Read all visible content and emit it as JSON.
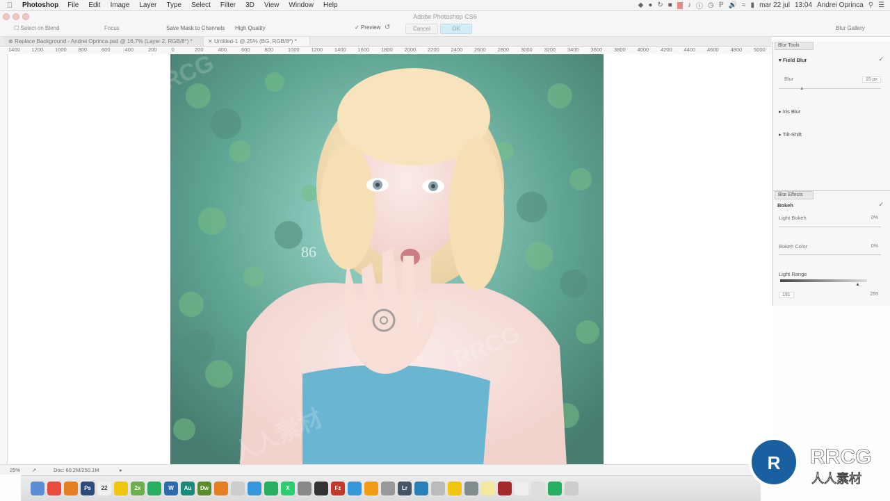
{
  "menubar": {
    "app": "Photoshop",
    "menus": [
      "File",
      "Edit",
      "Image",
      "Layer",
      "Type",
      "Select",
      "Filter",
      "3D",
      "View",
      "Window",
      "Help"
    ],
    "date": "mar 22 jul",
    "time": "13:04",
    "user": "Andrei Oprinca"
  },
  "window": {
    "title": "Adobe Photoshop CS6"
  },
  "options": {
    "select_on_blend": "Select on Blend",
    "focus": "Focus",
    "save_mask": "Save Mask to Channels",
    "high_quality": "High Quality",
    "preview": "Preview",
    "cancel": "Cancel",
    "ok": "OK",
    "blur_gallery": "Blur Gallery"
  },
  "tabs": [
    {
      "label": "Replace Background - Andrei Oprinca.psd @ 16.7% (Layer 2, RGB/8*) *"
    },
    {
      "label": "Untitled-1 @ 25% (BG, RGB/8*) *"
    }
  ],
  "ruler": {
    "ticks": [
      "1400",
      "1200",
      "1000",
      "800",
      "600",
      "400",
      "200",
      "0",
      "200",
      "400",
      "600",
      "800",
      "1000",
      "1200",
      "1400",
      "1600",
      "1800",
      "2000",
      "2200",
      "2400",
      "2600",
      "2800",
      "3000",
      "3200",
      "3400",
      "3600",
      "3800",
      "4000",
      "4200",
      "4400",
      "4600",
      "4800",
      "5000"
    ]
  },
  "status": {
    "zoom": "25%",
    "doc": "Doc: 60.2M/250.1M"
  },
  "blur_tools": {
    "tab": "Blur Tools",
    "field_blur": "Field Blur",
    "blur_label": "Blur",
    "blur_value": "15 px",
    "blur_level": 0.23,
    "iris_blur": "Iris Blur",
    "tilt_shift": "Tilt-Shift"
  },
  "blur_effects": {
    "tab": "Blur Effects",
    "bokeh": "Bokeh",
    "light_bokeh": "Light Bokeh",
    "light_bokeh_value": "0%",
    "bokeh_color": "Bokeh Color",
    "bokeh_color_value": "0%",
    "light_range": "Light Range",
    "light_range_min": "191",
    "light_range_max": "255"
  },
  "dock": {
    "items": [
      {
        "label": "",
        "color": "#5a8fd8",
        "name": "finder-icon"
      },
      {
        "label": "",
        "color": "#e74c3c",
        "name": "chrome-icon"
      },
      {
        "label": "",
        "color": "#e67e22",
        "name": "firefox-icon"
      },
      {
        "label": "Ps",
        "color": "#2c4a7a",
        "name": "photoshop-icon"
      },
      {
        "label": "22",
        "color": "#f0f0f0",
        "name": "calendar-icon"
      },
      {
        "label": "",
        "color": "#f1c40f",
        "name": "notes-icon"
      },
      {
        "label": "2x",
        "color": "#6ab04c",
        "name": "app-icon"
      },
      {
        "label": "",
        "color": "#27ae60",
        "name": "spotify-icon"
      },
      {
        "label": "W",
        "color": "#2b6cb0",
        "name": "word-icon"
      },
      {
        "label": "Au",
        "color": "#1a8a7a",
        "name": "audition-icon"
      },
      {
        "label": "Dw",
        "color": "#5b8c2a",
        "name": "dreamweaver-icon"
      },
      {
        "label": "",
        "color": "#e67e22",
        "name": "vlc-icon"
      },
      {
        "label": "",
        "color": "#cccccc",
        "name": "app2-icon"
      },
      {
        "label": "",
        "color": "#3498db",
        "name": "app3-icon"
      },
      {
        "label": "",
        "color": "#27ae60",
        "name": "drive-icon"
      },
      {
        "label": "X",
        "color": "#2ecc71",
        "name": "excel-icon"
      },
      {
        "label": "",
        "color": "#888888",
        "name": "app4-icon"
      },
      {
        "label": "",
        "color": "#333333",
        "name": "activity-icon"
      },
      {
        "label": "Fz",
        "color": "#c0392b",
        "name": "filezilla-icon"
      },
      {
        "label": "",
        "color": "#3498db",
        "name": "appstore-icon"
      },
      {
        "label": "",
        "color": "#f39c12",
        "name": "app5-icon"
      },
      {
        "label": "",
        "color": "#999999",
        "name": "app6-icon"
      },
      {
        "label": "Lr",
        "color": "#445566",
        "name": "lightroom-icon"
      },
      {
        "label": "",
        "color": "#2980b9",
        "name": "wordpress-icon"
      },
      {
        "label": "",
        "color": "#bbbbbb",
        "name": "app7-icon"
      },
      {
        "label": "",
        "color": "#f1c40f",
        "name": "app8-icon"
      },
      {
        "label": "",
        "color": "#7f8c8d",
        "name": "app9-icon"
      },
      {
        "label": "",
        "color": "#f4e89c",
        "name": "stickies-icon"
      },
      {
        "label": "",
        "color": "#a52a2a",
        "name": "app10-icon"
      },
      {
        "label": "",
        "color": "#eeeeee",
        "name": "doc-icon"
      },
      {
        "label": "",
        "color": "#dddddd",
        "name": "app11-icon"
      },
      {
        "label": "",
        "color": "#27ae60",
        "name": "app12-icon"
      },
      {
        "label": "",
        "color": "#cccccc",
        "name": "trash-icon"
      }
    ]
  },
  "watermark": {
    "main": "RRCG",
    "sub": "人人素材"
  }
}
